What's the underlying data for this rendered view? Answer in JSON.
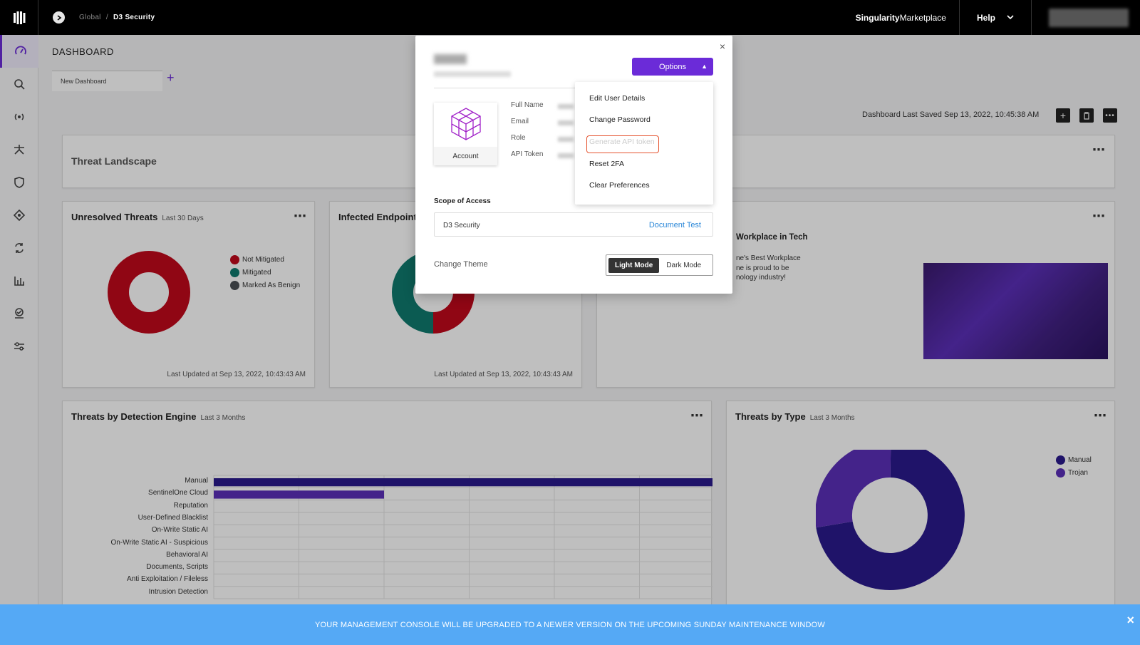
{
  "topbar": {
    "breadcrumb_parent": "Global",
    "breadcrumb_sep": "/",
    "breadcrumb_current": "D3 Security",
    "marketplace_bold": "Singularity",
    "marketplace": "Marketplace",
    "help": "Help"
  },
  "dashboard": {
    "title": "DASHBOARD",
    "tab": "New Dashboard",
    "add_tab": "+",
    "saved": "Dashboard Last Saved Sep 13, 2022, 10:45:38 AM"
  },
  "threat_landscape": {
    "title": "Threat Landscape"
  },
  "unresolved": {
    "title": "Unresolved Threats",
    "sub": "Last 30 Days",
    "updated": "Last Updated at Sep 13, 2022, 10:43:43 AM",
    "legend": [
      "Not Mitigated",
      "Mitigated",
      "Marked As Benign"
    ]
  },
  "infected": {
    "title": "Infected Endpoints",
    "updated": "Last Updated at Sep 13, 2022, 10:43:43 AM"
  },
  "news": {
    "title": "Workplace in Tech",
    "line1": "ne's Best Workplace",
    "line2": "ne is proud to be",
    "line3": "nology industry!"
  },
  "detection": {
    "title": "Threats by Detection Engine",
    "sub": "Last 3 Months"
  },
  "bytype": {
    "title": "Threats by Type",
    "sub": "Last 3 Months",
    "legend": [
      "Manual",
      "Trojan"
    ]
  },
  "modal": {
    "close": "×",
    "options": "Options",
    "account": "Account",
    "fields": [
      "Full Name",
      "Email",
      "Role",
      "API Token"
    ],
    "scope_label": "Scope of Access",
    "scope_name": "D3 Security",
    "scope_link": "Document Test",
    "theme_label": "Change Theme",
    "light": "Light Mode",
    "dark": "Dark Mode"
  },
  "menu": {
    "items": [
      "Edit User Details",
      "Change Password",
      "Generate API token",
      "Reset 2FA",
      "Clear Preferences"
    ]
  },
  "banner": {
    "text": "YOUR MANAGEMENT CONSOLE WILL BE UPGRADED TO A NEWER VERSION ON THE UPCOMING SUNDAY MAINTENANCE WINDOW",
    "close": "×"
  },
  "colors": {
    "accent": "#6b2bd8",
    "not_mitigated": "#c0081b",
    "mitigated": "#0f7a6e",
    "benign": "#4a4f55",
    "manual": "#2a1a8c",
    "trojan": "#5b2fb8",
    "banner": "#55a9f5"
  },
  "chart_data": [
    {
      "type": "bar",
      "title": "Threats by Detection Engine",
      "categories": [
        "Manual",
        "SentinelOne Cloud",
        "Reputation",
        "User-Defined Blacklist",
        "On-Write Static AI",
        "On-Write Static AI - Suspicious",
        "Behavioral AI",
        "Documents, Scripts",
        "Anti Exploitation / Fileless",
        "Intrusion Detection"
      ],
      "values": [
        3,
        1,
        0,
        0,
        0,
        0,
        0,
        0,
        0,
        0
      ],
      "xlim": [
        0,
        3
      ],
      "xticks": [
        "0",
        "0.5",
        "1",
        "1.5",
        "2",
        "2.5",
        "3"
      ]
    },
    {
      "type": "pie",
      "title": "Threats by Type",
      "labels": [
        "Manual",
        "Trojan"
      ],
      "values": [
        75,
        25
      ]
    },
    {
      "type": "pie",
      "title": "Unresolved Threats",
      "labels": [
        "Not Mitigated",
        "Mitigated",
        "Marked As Benign"
      ],
      "values": [
        100,
        0,
        0
      ]
    }
  ]
}
